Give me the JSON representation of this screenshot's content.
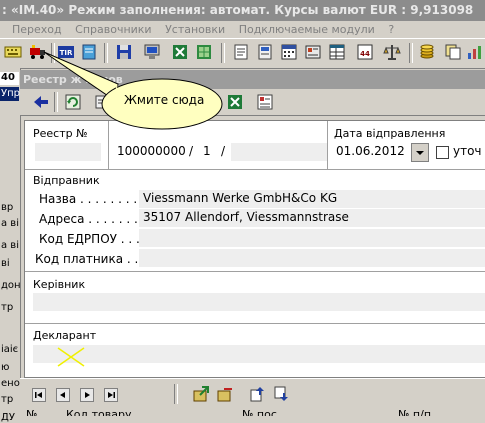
{
  "window": {
    "title": ": «IM.40»  Режим заполнения: автомат.  Курсы валют  EUR : 9,913098"
  },
  "menu": [
    "Переход",
    "Справочники",
    "Установки",
    "Подключаемые модули",
    "?"
  ],
  "toolbar": {
    "icons": [
      "keyboard-icon",
      "truck-icon",
      "tir-icon",
      "notebook-icon",
      "save-icon",
      "computer-icon",
      "excel-icon",
      "spreadsheet-icon",
      "document-icon",
      "printer-icon",
      "calendar-icon",
      "card-icon",
      "table-icon",
      "form-44-icon",
      "scales-icon",
      "coins-icon",
      "copy-icon"
    ],
    "tir_label": "TIR",
    "form44_label": "44"
  },
  "left_pane": {
    "texts": [
      "40",
      "Упр",
      "вр",
      "а ві",
      "а ві",
      "ві",
      "дон",
      "тр",
      "іаіє",
      "ю",
      "ено",
      "тр",
      "ДУ"
    ]
  },
  "child": {
    "title": "Реестр ж       ионов",
    "icons": [
      "back-arrow-icon",
      "refresh-icon",
      "edit-icon",
      "excel-icon",
      "grid-icon"
    ]
  },
  "form": {
    "registry_label": "Реестр №",
    "registry_value": "",
    "number_value": "100000000",
    "number_sep1": "/",
    "number_part": "1",
    "number_sep2": "/",
    "date_label": "Дата відправлення",
    "date_value": "01.06.2012",
    "clarify_label": "уточ",
    "sender_section": "Відправник",
    "name_label": "Назва . . . . . . . . .",
    "name_value": "Viessmann Werke GmbH&Co KG",
    "address_label": "Адреса . . . . . . . .",
    "address_value": "35107 Allendorf, Viessmannstrase",
    "edrpou_label": "Код ЕДРПОУ . . .",
    "edrpou_value": "",
    "payer_label": "Код платника . . .",
    "payer_value": "",
    "manager_section": "Керівник",
    "manager_value": "",
    "declarant_section": "Декларант",
    "declarant_value": ""
  },
  "bottom": {
    "nav": [
      "first-icon",
      "prev-icon",
      "next-icon",
      "last-icon"
    ],
    "grid_cols": [
      "№",
      "Код товару",
      "№ пос",
      "№ п/п"
    ]
  },
  "tooltip": {
    "text": "Жмите сюда"
  }
}
